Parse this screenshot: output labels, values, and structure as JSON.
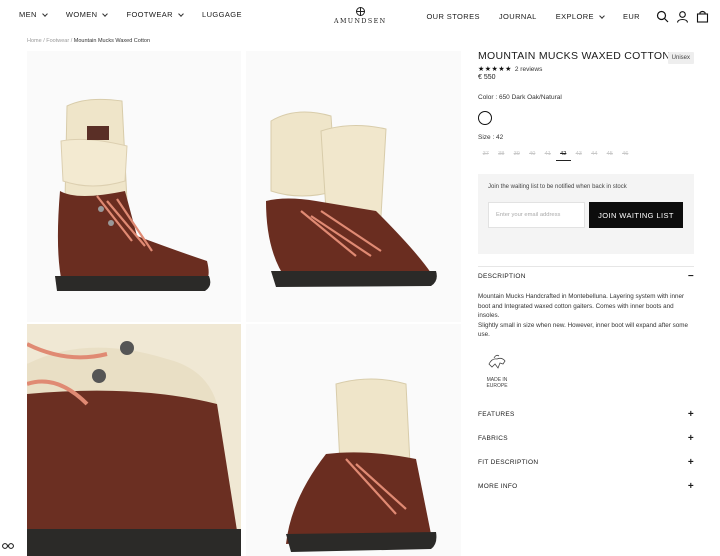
{
  "header": {
    "nav_left": [
      "MEN",
      "WOMEN",
      "FOOTWEAR",
      "LUGGAGE"
    ],
    "logo": "AMUNDSEN",
    "nav_right": [
      "OUR STORES",
      "JOURNAL",
      "EXPLORE",
      "EUR"
    ],
    "icons": [
      "search-icon",
      "account-icon",
      "bag-icon"
    ]
  },
  "breadcrumb": {
    "home": "Home",
    "sep1": "/",
    "category": "Footwear",
    "sep2": "/",
    "current": "Mountain Mucks Waxed Cotton"
  },
  "product": {
    "title": "MOUNTAIN MUCKS WAXED COTTON",
    "badge": "Unisex",
    "stars": "★★★★★",
    "rating": 5,
    "reviews": "2 reviews",
    "price": "€ 550",
    "color_label": "Color : 650 Dark Oak/Natural",
    "size_label": "Size : 42",
    "sizes": [
      "37",
      "38",
      "39",
      "40",
      "41",
      "42",
      "43",
      "44",
      "45",
      "46"
    ],
    "selected_size": "42"
  },
  "waitlist": {
    "text": "Join the waiting list to be notified when back in stock",
    "email_placeholder": "Enter your email address",
    "button": "JOIN WAITING LIST"
  },
  "sections": {
    "description": "DESCRIPTION",
    "description_text_1": "Mountain Mucks Handcrafted in Montebelluna. Layering system with inner boot and Integrated waxed cotton gaiters. Comes with inner boots and insoles.",
    "description_text_2": "Slightly small in size when new. However, inner boot will expand after some use.",
    "made_in_line1": "MADE IN",
    "made_in_line2": "EUROPE",
    "features": "FEATURES",
    "fabrics": "FABRICS",
    "fit": "FIT DESCRIPTION",
    "more": "MORE INFO",
    "minus": "−",
    "plus": "+"
  },
  "colors": {
    "accent": "#0d0d0d",
    "leather": "#6b2f22",
    "canvas": "#efe4c8",
    "lace": "#e08a73"
  }
}
